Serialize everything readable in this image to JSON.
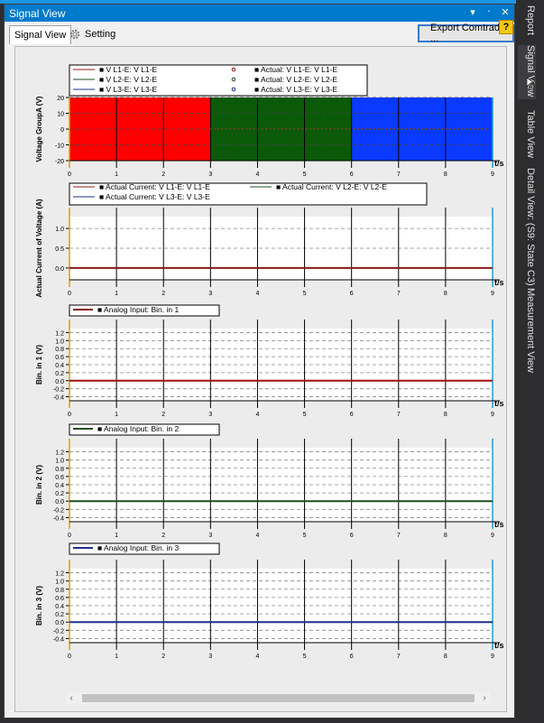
{
  "window": {
    "title": "Signal View",
    "pin_label": "▾ ᛫ ✕"
  },
  "tabs": {
    "signal_view": "Signal View",
    "setting": "Setting"
  },
  "toolbar": {
    "export_label": "Export Comtrade ...",
    "help_label": "?"
  },
  "side_tabs": [
    "Report",
    "Signal View",
    "Table View",
    "Detail View: (S9: State C3)",
    "Measurement View"
  ],
  "colors": {
    "title_bar": "#007acc",
    "red": "#ff0000",
    "green": "#0a5a0a",
    "blue": "#0a39ff",
    "dark_red": "#8b1a1a",
    "dark_green": "#1f4d1f",
    "dark_blue": "#1f2f8b",
    "start_marker": "#e0a000",
    "end_marker": "#1aa0d0"
  },
  "chart_data": [
    {
      "type": "area",
      "ylabel": "Voltage GroupA (V)",
      "xlabel": "t/s",
      "x_ticks": [
        "0",
        "1",
        "2",
        "3",
        "4",
        "5",
        "6",
        "7",
        "8",
        "9"
      ],
      "y_ticks": [
        "20",
        "10",
        "0",
        "-10",
        "-20"
      ],
      "ylim": [
        -20,
        20
      ],
      "xlim": [
        0,
        9
      ],
      "legend": [
        {
          "label": "V L1-E: V L1-E",
          "color": "#8b1a1a"
        },
        {
          "label": "Actual: V L1-E: V L1-E",
          "color": "#8b1a1a"
        },
        {
          "label": "V L2-E: V L2-E",
          "color": "#1f4d1f"
        },
        {
          "label": "Actual: V L2-E: V L2-E",
          "color": "#1f4d1f"
        },
        {
          "label": "V L3-E: V L3-E",
          "color": "#1f2f8b"
        },
        {
          "label": "Actual: V L3-E: V L3-E",
          "color": "#1f2f8b"
        }
      ],
      "series": [
        {
          "name": "V L1-E: V L1-E",
          "x": [
            0,
            3
          ],
          "amplitude": 20,
          "color": "#ff0000"
        },
        {
          "name": "V L2-E: V L2-E",
          "x": [
            3,
            6
          ],
          "amplitude": 20,
          "color": "#0a5a0a"
        },
        {
          "name": "V L3-E: V L3-E",
          "x": [
            6,
            9
          ],
          "amplitude": 20,
          "color": "#0a39ff"
        }
      ]
    },
    {
      "type": "line",
      "ylabel": "Actual Current of Voltage (A)",
      "xlabel": "t/s",
      "x_ticks": [
        "0",
        "1",
        "2",
        "3",
        "4",
        "5",
        "6",
        "7",
        "8",
        "9"
      ],
      "y_ticks": [
        "1.0",
        "0.5",
        "0.0"
      ],
      "ylim": [
        -0.3,
        1.3
      ],
      "xlim": [
        0,
        9
      ],
      "legend": [
        {
          "label": "Actual Current: V L1-E: V L1-E",
          "color": "#8b1a1a"
        },
        {
          "label": "Actual Current: V L2-E: V L2-E",
          "color": "#1f4d1f"
        },
        {
          "label": "Actual Current: V L3-E: V L3-E",
          "color": "#1f2f8b"
        }
      ],
      "series": [
        {
          "name": "Actual Current: V L1-E: V L1-E",
          "x": [
            0,
            9
          ],
          "y": [
            0,
            0
          ],
          "color": "#8b1a1a"
        }
      ]
    },
    {
      "type": "line",
      "ylabel": "Bin. in 1 (V)",
      "xlabel": "t/s",
      "x_ticks": [
        "0",
        "1",
        "2",
        "3",
        "4",
        "5",
        "6",
        "7",
        "8",
        "9"
      ],
      "y_ticks": [
        "1.2",
        "1.0",
        "0.8",
        "0.6",
        "0.4",
        "0.2",
        "0.0",
        "-0.2",
        "-0.4"
      ],
      "ylim": [
        -0.5,
        1.3
      ],
      "xlim": [
        0,
        9
      ],
      "legend": [
        {
          "label": "Analog Input: Bin. in 1",
          "color": "#8b1a1a"
        }
      ],
      "series": [
        {
          "name": "Analog Input: Bin. in 1",
          "x": [
            0,
            9
          ],
          "y": [
            0,
            0
          ],
          "color": "#a01010"
        }
      ]
    },
    {
      "type": "line",
      "ylabel": "Bin. in 2 (V)",
      "xlabel": "t/s",
      "x_ticks": [
        "0",
        "1",
        "2",
        "3",
        "4",
        "5",
        "6",
        "7",
        "8",
        "9"
      ],
      "y_ticks": [
        "1.2",
        "1.0",
        "0.8",
        "0.6",
        "0.4",
        "0.2",
        "0.0",
        "-0.2",
        "-0.4"
      ],
      "ylim": [
        -0.5,
        1.3
      ],
      "xlim": [
        0,
        9
      ],
      "legend": [
        {
          "label": "Analog Input: Bin. in 2",
          "color": "#1f4d1f"
        }
      ],
      "series": [
        {
          "name": "Analog Input: Bin. in 2",
          "x": [
            0,
            9
          ],
          "y": [
            0,
            0
          ],
          "color": "#1f4d1f"
        }
      ]
    },
    {
      "type": "line",
      "ylabel": "Bin. in 3 (V)",
      "xlabel": "t/s",
      "x_ticks": [
        "0",
        "1",
        "2",
        "3",
        "4",
        "5",
        "6",
        "7",
        "8",
        "9"
      ],
      "y_ticks": [
        "1.2",
        "1.0",
        "0.8",
        "0.6",
        "0.4",
        "0.2",
        "0.0",
        "-0.2",
        "-0.4"
      ],
      "ylim": [
        -0.5,
        1.3
      ],
      "xlim": [
        0,
        9
      ],
      "legend": [
        {
          "label": "Analog Input: Bin. in 3",
          "color": "#1f2f8b"
        }
      ],
      "series": [
        {
          "name": "Analog Input: Bin. in 3",
          "x": [
            0,
            9
          ],
          "y": [
            0,
            0
          ],
          "color": "#1f2f8b"
        }
      ]
    }
  ]
}
